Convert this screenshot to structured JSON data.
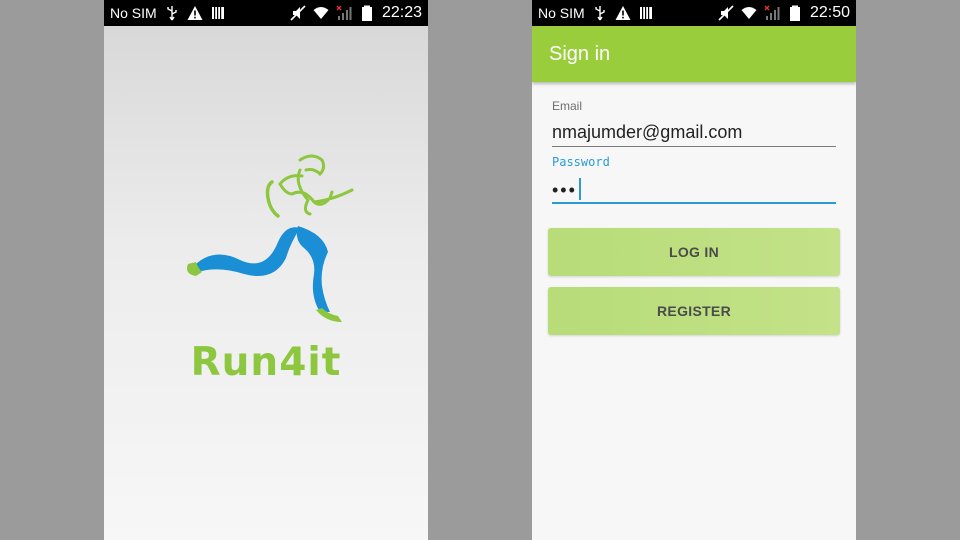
{
  "left_screen": {
    "status_bar": {
      "carrier": "No SIM",
      "time": "22:23"
    },
    "brand_name": "Run4it",
    "logo_icon": "runner-logo-icon",
    "colors": {
      "brand_green": "#8dc63f",
      "brand_blue": "#1a8fd6"
    }
  },
  "right_screen": {
    "status_bar": {
      "carrier": "No SIM",
      "time": "22:50"
    },
    "app_bar": {
      "title": "Sign in"
    },
    "form": {
      "email": {
        "label": "Email",
        "value": "nmajumder@gmail.com"
      },
      "password": {
        "label": "Password",
        "value": "•••"
      }
    },
    "buttons": {
      "login": "LOG IN",
      "register": "REGISTER"
    },
    "colors": {
      "app_bar": "#9acd3c",
      "accent": "#2a9bd6",
      "button": "#bfe083"
    }
  },
  "status_icons": [
    "usb-icon",
    "warning-icon",
    "storage-icon",
    "mute-icon",
    "wifi-icon",
    "no-signal-icon",
    "battery-icon"
  ]
}
